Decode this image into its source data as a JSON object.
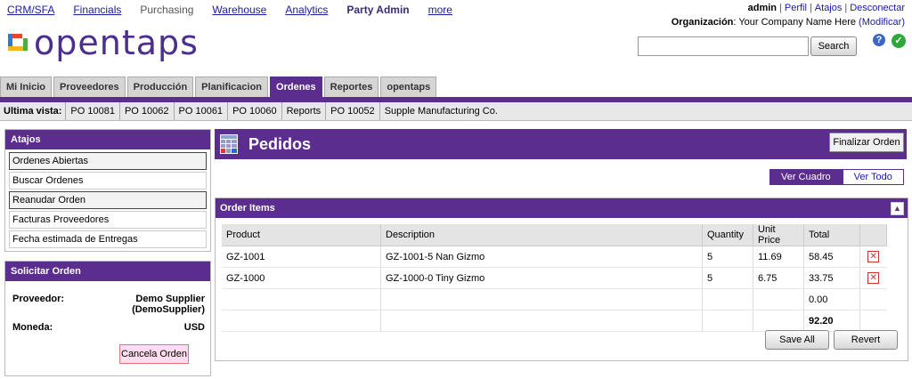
{
  "top_nav": [
    {
      "label": "CRM/SFA",
      "style": "link"
    },
    {
      "label": "Financials",
      "style": "link"
    },
    {
      "label": "Purchasing",
      "style": "plain"
    },
    {
      "label": "Warehouse",
      "style": "link"
    },
    {
      "label": "Analytics",
      "style": "link"
    },
    {
      "label": "Party Admin",
      "style": "bold"
    },
    {
      "label": "more",
      "style": "link"
    }
  ],
  "user": {
    "name": "admin",
    "links": [
      "Perfil",
      "Atajos",
      "Desconectar"
    ],
    "org_label": "Organización",
    "org_name": "Your Company Name Here",
    "org_modify": "(Modificar)"
  },
  "logo_text": "opentaps",
  "search": {
    "placeholder": "",
    "value": "",
    "button": "Search"
  },
  "icons": {
    "help": "?",
    "ok": "✓"
  },
  "tabs": [
    {
      "label": "Mi Inicio",
      "active": false
    },
    {
      "label": "Proveedores",
      "active": false
    },
    {
      "label": "Producción",
      "active": false
    },
    {
      "label": "Planificacion",
      "active": false
    },
    {
      "label": "Ordenes",
      "active": true
    },
    {
      "label": "Reportes",
      "active": false
    },
    {
      "label": "opentaps",
      "active": false
    }
  ],
  "recent": {
    "label": "Ultima vista:",
    "items": [
      "PO 10081",
      "PO 10062",
      "PO 10061",
      "PO 10060",
      "Reports",
      "PO 10052",
      "Supple Manufacturing Co."
    ]
  },
  "atajos": {
    "title": "Atajos",
    "items": [
      {
        "label": "Ordenes Abiertas",
        "highlight": true
      },
      {
        "label": "Buscar Ordenes",
        "highlight": false
      },
      {
        "label": "Reanudar Orden",
        "highlight": true
      },
      {
        "label": "Facturas Proveedores",
        "highlight": false
      },
      {
        "label": "Fecha estimada de Entregas",
        "highlight": false
      }
    ]
  },
  "solicitar": {
    "title": "Solicitar Orden",
    "proveedor_label": "Proveedor:",
    "proveedor_value_1": "Demo Supplier",
    "proveedor_value_2": "(DemoSupplier)",
    "moneda_label": "Moneda:",
    "moneda_value": "USD",
    "cancel": "Cancela Orden"
  },
  "pedidos": {
    "title": "Pedidos",
    "finalizar": "Finalizar Orden"
  },
  "view_toggle": {
    "on": "Ver Cuadro",
    "off": "Ver Todo"
  },
  "order_items": {
    "title": "Order Items",
    "collapse": "▲",
    "columns": [
      "Product",
      "Description",
      "Quantity",
      "Unit Price",
      "Total",
      ""
    ],
    "rows": [
      {
        "product": "GZ-1001",
        "description": "GZ-1001-5 Nan Gizmo",
        "quantity": "5",
        "unit_price": "11.69",
        "total": "58.45"
      },
      {
        "product": "GZ-1000",
        "description": "GZ-1000-0 Tiny Gizmo",
        "quantity": "5",
        "unit_price": "6.75",
        "total": "33.75"
      }
    ],
    "extra_total": "0.00",
    "grand_total": "92.20",
    "save": "Save All",
    "revert": "Revert"
  }
}
